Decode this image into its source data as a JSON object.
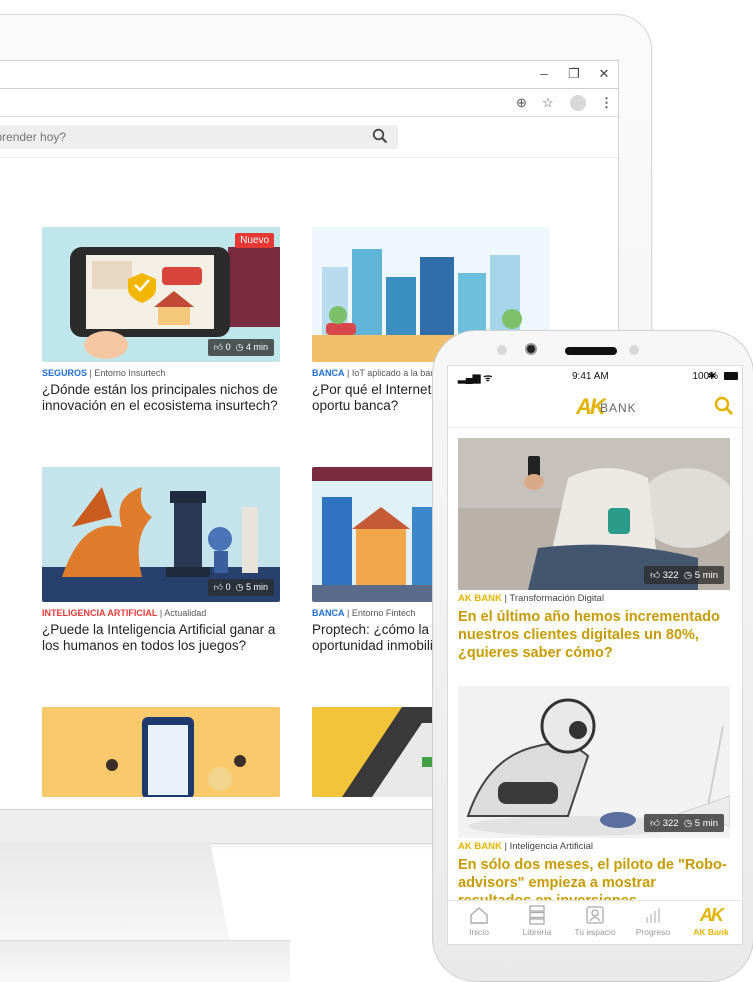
{
  "browser": {
    "search_placeholder": "quieres aprender hoy?"
  },
  "cards": [
    {
      "category": "SEGUROS",
      "category_color": "#1e6fd0",
      "subcategory": "Entorno Insurtech",
      "title": "¿Dónde están los principales nichos de innovación en el ecosistema insurtech?",
      "badge": "Nuevo",
      "likes": "0",
      "duration": "4 min"
    },
    {
      "category": "BANCA",
      "category_color": "#1e6fd0",
      "subcategory": "IoT aplicado a la banc",
      "title": "¿Por qué el Internet de puede ser una oportu banca?"
    },
    {
      "category": "INTELIGENCIA ARTIFICIAL",
      "category_color": "#e53935",
      "subcategory": "Actualidad",
      "title": "¿Puede la Inteligencia Artificial ganar a los humanos en todos los juegos?",
      "likes": "0",
      "duration": "5 min"
    },
    {
      "category": "BANCA",
      "category_color": "#1e6fd0",
      "subcategory": "Entorno Fintech",
      "title": "Proptech: ¿cómo la te creando oportunidad inmobiliario?"
    }
  ],
  "phone": {
    "time": "9:41 AM",
    "battery": "100%",
    "brand": "BANK",
    "posts": [
      {
        "category": "AK BANK",
        "subcategory": "Transformación Digital",
        "title": "En el último año hemos incrementado nuestros clientes digitales un 80%, ¿quieres saber cómo?",
        "likes": "322",
        "duration": "5 min"
      },
      {
        "category": "AK BANK",
        "subcategory": "Inteligencia Artificial",
        "title": "En sólo dos meses, el piloto de \"Robo-advisors\" empieza a mostrar resultados en inversiones",
        "likes": "322",
        "duration": "5 min"
      }
    ],
    "tabs": [
      {
        "label": "Inicio"
      },
      {
        "label": "Librería"
      },
      {
        "label": "Tu espacio"
      },
      {
        "label": "Progreso"
      },
      {
        "label": "AK Bank"
      }
    ]
  },
  "colors": {
    "accent": "#e0b400",
    "blue": "#1e6fd0",
    "red": "#e53935"
  }
}
